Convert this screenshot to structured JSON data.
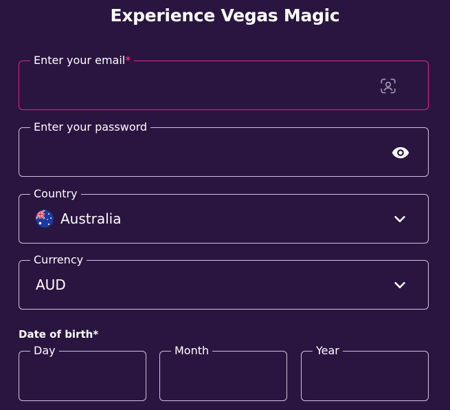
{
  "title": "Experience Vegas Magic",
  "email": {
    "label": "Enter your email",
    "required_mark": "*",
    "value": "",
    "icon": "face-scan-icon"
  },
  "password": {
    "label": "Enter your password",
    "value": "",
    "icon": "eye-icon"
  },
  "country": {
    "label": "Country",
    "value": "Australia",
    "flag_icon": "australia-flag-icon",
    "icon": "chevron-down-icon"
  },
  "currency": {
    "label": "Currency",
    "value": "AUD",
    "icon": "chevron-down-icon"
  },
  "dob": {
    "heading": "Date of birth*",
    "day_label": "Day",
    "month_label": "Month",
    "year_label": "Year"
  },
  "colors": {
    "background": "#2a1540",
    "focus_border": "#e0288e",
    "border": "#cfc4dc",
    "required": "#ff3d7f",
    "text": "#ffffff"
  }
}
